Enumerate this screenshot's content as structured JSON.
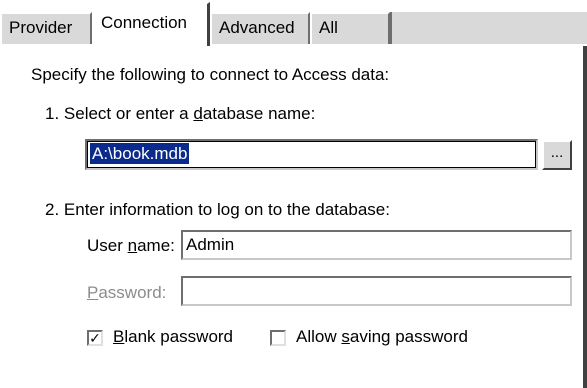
{
  "tabs": [
    {
      "label": "Provider"
    },
    {
      "label": "Connection"
    },
    {
      "label": "Advanced"
    },
    {
      "label": "All"
    }
  ],
  "active_tab": "Connection",
  "intro_text": "Specify the following to connect to Access data:",
  "step1": {
    "label_prefix": "1. Select or enter a ",
    "label_mnemonic": "d",
    "label_suffix": "atabase name:",
    "database_value": "A:\\book.mdb",
    "browse_label": "..."
  },
  "step2": {
    "label": "2. Enter information to log on to the database:",
    "username_label_prefix": "User ",
    "username_label_mnemonic": "n",
    "username_label_suffix": "ame:",
    "username_value": "Admin",
    "password_label_mnemonic": "P",
    "password_label_suffix": "assword:",
    "password_value": ""
  },
  "options": {
    "blank_password_mnemonic": "B",
    "blank_password_suffix": "lank password",
    "blank_password_checked": true,
    "check_glyph": "✓",
    "allow_saving_prefix": "Allow ",
    "allow_saving_mnemonic": "s",
    "allow_saving_suffix": "aving password",
    "allow_saving_checked": false
  }
}
